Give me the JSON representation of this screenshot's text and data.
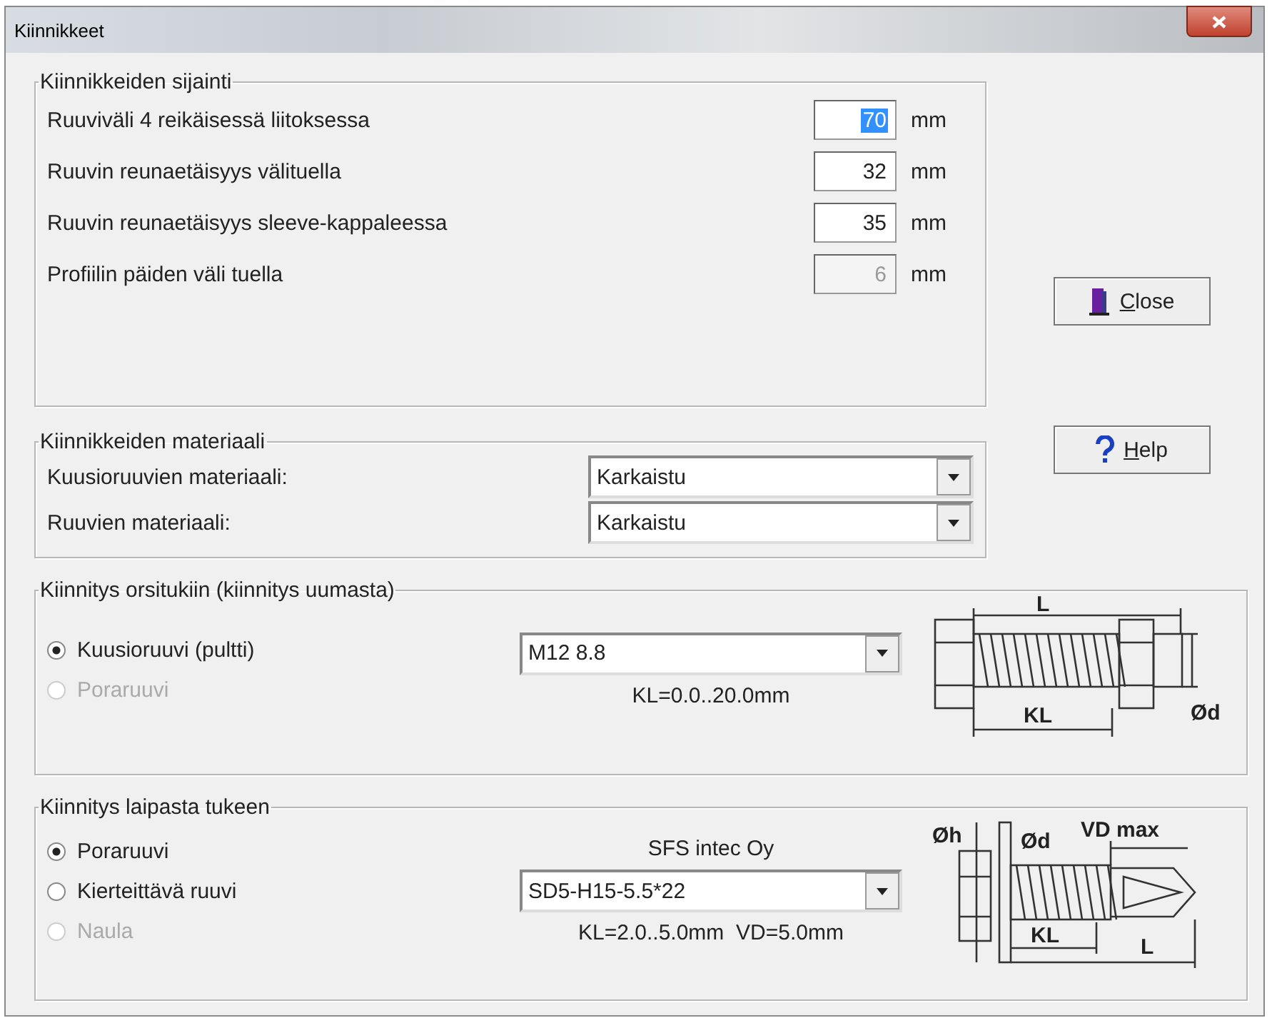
{
  "window": {
    "title": "Kiinnikkeet"
  },
  "location_group": {
    "title": "Kiinnikkeiden sijainti",
    "rows": [
      {
        "label": "Ruuviväli 4 reikäisessä liitoksessa",
        "value": "70",
        "unit": "mm",
        "selected": true,
        "disabled": false
      },
      {
        "label": "Ruuvin reunaetäisyys välituella",
        "value": "32",
        "unit": "mm",
        "selected": false,
        "disabled": false
      },
      {
        "label": "Ruuvin reunaetäisyys sleeve-kappaleessa",
        "value": "35",
        "unit": "mm",
        "selected": false,
        "disabled": false
      },
      {
        "label": "Profiilin päiden väli tuella",
        "value": "6",
        "unit": "mm",
        "selected": false,
        "disabled": true
      }
    ]
  },
  "material_group": {
    "title": "Kiinnikkeiden materiaali",
    "rows": [
      {
        "label": "Kuusioruuvien materiaali:",
        "value": "Karkaistu"
      },
      {
        "label": "Ruuvien materiaali:",
        "value": "Karkaistu"
      }
    ]
  },
  "buttons": [
    {
      "label": "Close",
      "kind": "close"
    },
    {
      "label": "Help",
      "kind": "help"
    }
  ],
  "purlin_group": {
    "title": "Kiinnitys orsitukiin (kiinnitys uumasta)",
    "options": [
      {
        "label": "Kuusioruuvi (pultti)",
        "selected": true,
        "disabled": false
      },
      {
        "label": "Poraruuvi",
        "selected": false,
        "disabled": true
      }
    ],
    "select": {
      "value": "M12 8.8"
    },
    "note": "KL=0.0..20.0mm",
    "diagram": {
      "kind": "bolt",
      "labels": [
        "L",
        "KL",
        "Ød"
      ]
    }
  },
  "flange_group": {
    "title": "Kiinnitys laipasta tukeen",
    "options": [
      {
        "label": "Poraruuvi",
        "selected": true,
        "disabled": false
      },
      {
        "label": "Kierteittävä ruuvi",
        "selected": false,
        "disabled": false
      },
      {
        "label": "Naula",
        "selected": false,
        "disabled": true
      }
    ],
    "caption": "SFS intec Oy",
    "select": {
      "value": "SD5-H15-5.5*22"
    },
    "note": "KL=2.0..5.0mm  VD=5.0mm",
    "diagram": {
      "kind": "drill_screw",
      "labels": [
        "Øh",
        "Ød",
        "VD max",
        "KL",
        "L"
      ]
    }
  }
}
